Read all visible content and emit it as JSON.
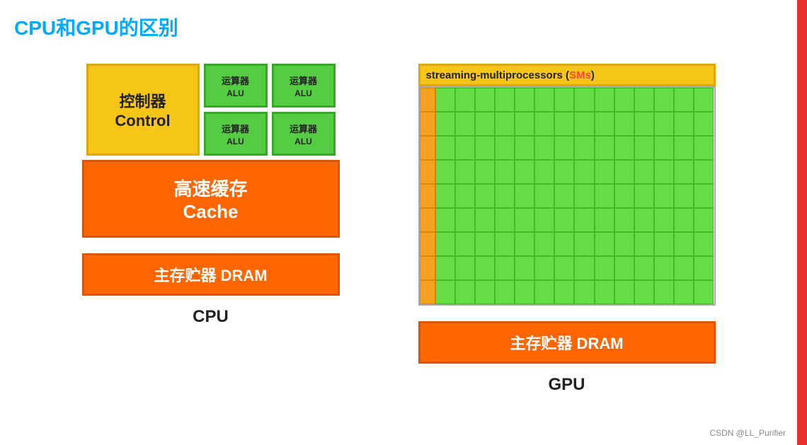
{
  "title": "CPU和GPU的区别",
  "red_bar": true,
  "cpu": {
    "control_label_cn": "控制器",
    "control_label_en": "Control",
    "alu_items": [
      {
        "cn": "运算器",
        "en": "ALU"
      },
      {
        "cn": "运算器",
        "en": "ALU"
      },
      {
        "cn": "运算器",
        "en": "ALU"
      },
      {
        "cn": "运算器",
        "en": "ALU"
      }
    ],
    "cache_label_cn": "高速缓存",
    "cache_label_en": "Cache",
    "dram_label": "主存贮器 DRAM",
    "diagram_label": "CPU"
  },
  "gpu": {
    "sm_header_text": "streaming-multiprocessors (",
    "sm_highlight": "SMs",
    "sm_header_close": ")",
    "num_rows": 9,
    "num_cells_per_row": 14,
    "dram_label": "主存贮器 DRAM",
    "diagram_label": "GPU"
  },
  "watermark": "CSDN @LL_Purifier"
}
